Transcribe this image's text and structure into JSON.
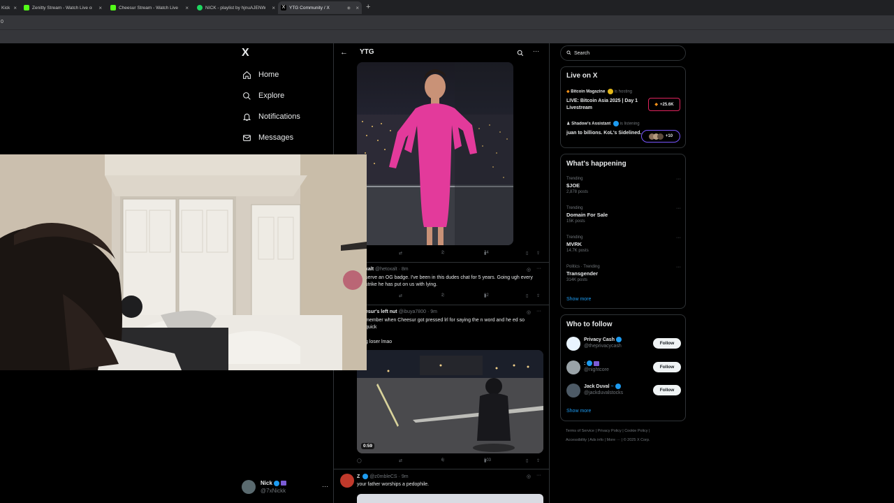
{
  "browser": {
    "tabs": [
      {
        "title": "Kick",
        "color": "#53fc18"
      },
      {
        "title": "Zenitty Stream - Watch Live on Kick",
        "color": "#53fc18"
      },
      {
        "title": "Cheesur Stream - Watch Live on Kick",
        "color": "#53fc18"
      },
      {
        "title": "NICK - playlist by hjnuAJENWP",
        "color": "#1ed760"
      },
      {
        "title": "YTG Community / X",
        "color": "#000000"
      }
    ],
    "address_fragment": "0"
  },
  "nav": {
    "logo": "X",
    "items": [
      {
        "label": "Home",
        "icon": "home-icon"
      },
      {
        "label": "Explore",
        "icon": "search-icon"
      },
      {
        "label": "Notifications",
        "icon": "bell-icon"
      },
      {
        "label": "Messages",
        "icon": "mail-icon"
      }
    ],
    "profile": {
      "name": "Nick",
      "handle": "@7xNickk"
    }
  },
  "community": {
    "back": "←",
    "title": "YTG",
    "posts": [
      {
        "stats": {
          "likes": "2",
          "views": "74"
        }
      },
      {
        "name": "xalt",
        "handle": "@hetoxalt",
        "time": "8m",
        "text": "serve an OG badge. I've been in this dudes chat for 5 years. Going ugh every strike he has put on us with lying.",
        "stats": {
          "likes": "2",
          "views": "92"
        }
      },
      {
        "name": "esur's left nut",
        "handle": "@ibuya7800",
        "time": "9m",
        "text_1": "member when Cheesur got pressed lrl for saying the n word and he ed so quick",
        "text_2": "g loser lmao",
        "video_duration": "0:59",
        "stats": {
          "likes": "6",
          "views": "103"
        }
      },
      {
        "name": "Z",
        "handle": "@z0mbleCS",
        "time": "9m",
        "text": "your father worships a pedophile."
      }
    ]
  },
  "right": {
    "search_placeholder": "Search",
    "live": {
      "title": "Live on X",
      "items": [
        {
          "host": "Bitcoin Magazine",
          "status": "is hosting",
          "title": "LIVE: Bitcoin Asia 2025 | Day 1 Livestream",
          "count": "+25.6K"
        },
        {
          "host": "Shadow's Assistant",
          "status": "is listening",
          "title": "juan to billions. KoL's Sidelined.",
          "count": "+10"
        }
      ]
    },
    "happening": {
      "title": "What's happening",
      "trends": [
        {
          "category": "Trending",
          "name": "$JOE",
          "count": "2,878 posts"
        },
        {
          "category": "Trending",
          "name": "Domain For Sale",
          "count": "15K posts"
        },
        {
          "category": "Trending",
          "name": "MVRK",
          "count": "14.7K posts"
        },
        {
          "category": "Politics · Trending",
          "name": "Transgender",
          "count": "314K posts"
        }
      ],
      "show_more": "Show more"
    },
    "follow": {
      "title": "Who to follow",
      "users": [
        {
          "name": "Privacy Cash",
          "handle": "@theprivacycash",
          "button": "Follow"
        },
        {
          "name": "",
          "handle": "@nightcore",
          "button": "Follow"
        },
        {
          "name": "Jack Duval",
          "handle": "@jackduvalstocks",
          "button": "Follow"
        }
      ],
      "show_more": "Show more"
    },
    "footer": {
      "line1": [
        "Terms of Service",
        "Privacy Policy",
        "Cookie Policy"
      ],
      "line2": [
        "Accessibility",
        "Ads info",
        "More ···",
        "© 2025 X Corp."
      ]
    }
  }
}
